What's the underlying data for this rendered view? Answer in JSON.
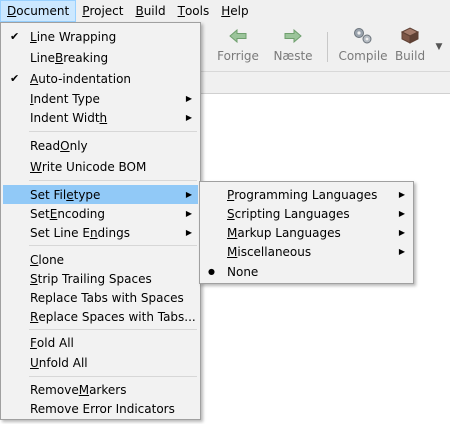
{
  "menubar": {
    "items": [
      {
        "accel": "D",
        "rest": "ocument"
      },
      {
        "accel": "P",
        "rest": "roject"
      },
      {
        "accel": "B",
        "rest": "uild"
      },
      {
        "accel": "T",
        "rest": "ools"
      },
      {
        "accel": "H",
        "rest": "elp"
      }
    ]
  },
  "toolbar": {
    "back_label": "Forrige",
    "forward_label": "Næste",
    "compile_label": "Compile",
    "build_label": "Build",
    "disabled_color": "#7a7a7a"
  },
  "document_menu": {
    "items": [
      {
        "check": "✔",
        "pre": "",
        "accel": "L",
        "post": "ine Wrapping",
        "arrow": ""
      },
      {
        "check": "",
        "pre": "Line ",
        "accel": "B",
        "post": "reaking",
        "arrow": ""
      },
      {
        "check": "✔",
        "pre": "",
        "accel": "A",
        "post": "uto-indentation",
        "arrow": ""
      },
      {
        "check": "",
        "pre": "",
        "accel": "I",
        "post": "ndent Type",
        "arrow": "▶"
      },
      {
        "check": "",
        "pre": "Indent Widt",
        "accel": "h",
        "post": "",
        "arrow": "▶"
      },
      {
        "check": "",
        "pre": "Read ",
        "accel": "O",
        "post": "nly",
        "arrow": ""
      },
      {
        "check": "",
        "pre": "",
        "accel": "W",
        "post": "rite Unicode BOM",
        "arrow": ""
      },
      {
        "check": "",
        "pre": "Set Fil",
        "accel": "e",
        "post": "type",
        "arrow": "▶"
      },
      {
        "check": "",
        "pre": "Set ",
        "accel": "E",
        "post": "ncoding",
        "arrow": "▶"
      },
      {
        "check": "",
        "pre": "Set Line E",
        "accel": "n",
        "post": "dings",
        "arrow": "▶"
      },
      {
        "check": "",
        "pre": "",
        "accel": "C",
        "post": "lone",
        "arrow": ""
      },
      {
        "check": "",
        "pre": "",
        "accel": "S",
        "post": "trip Trailing Spaces",
        "arrow": ""
      },
      {
        "check": "",
        "pre": "Replace Tabs with Spaces",
        "accel": "",
        "post": "",
        "arrow": ""
      },
      {
        "check": "",
        "pre": "",
        "accel": "R",
        "post": "eplace Spaces with Tabs...",
        "arrow": ""
      },
      {
        "check": "",
        "pre": "",
        "accel": "F",
        "post": "old All",
        "arrow": ""
      },
      {
        "check": "",
        "pre": "",
        "accel": "U",
        "post": "nfold All",
        "arrow": ""
      },
      {
        "check": "",
        "pre": "Remove ",
        "accel": "M",
        "post": "arkers",
        "arrow": ""
      },
      {
        "check": "",
        "pre": "Remove Error Indicators",
        "accel": "",
        "post": "",
        "arrow": ""
      }
    ]
  },
  "filetype_menu": {
    "items": [
      {
        "check": "",
        "pre": "",
        "accel": "P",
        "post": "rogramming Languages",
        "arrow": "▶"
      },
      {
        "check": "",
        "pre": "",
        "accel": "S",
        "post": "cripting Languages",
        "arrow": "▶"
      },
      {
        "check": "",
        "pre": "",
        "accel": "M",
        "post": "arkup Languages",
        "arrow": "▶"
      },
      {
        "check": "",
        "pre": "",
        "accel": "M",
        "post": "iscellaneous",
        "arrow": "▶"
      },
      {
        "check": "●",
        "pre": "None",
        "accel": "",
        "post": "",
        "arrow": ""
      }
    ]
  },
  "colors": {
    "highlight": "#91c9f7",
    "menubar_active": "#cce8ff",
    "menu_bg": "#f2f2f2"
  }
}
